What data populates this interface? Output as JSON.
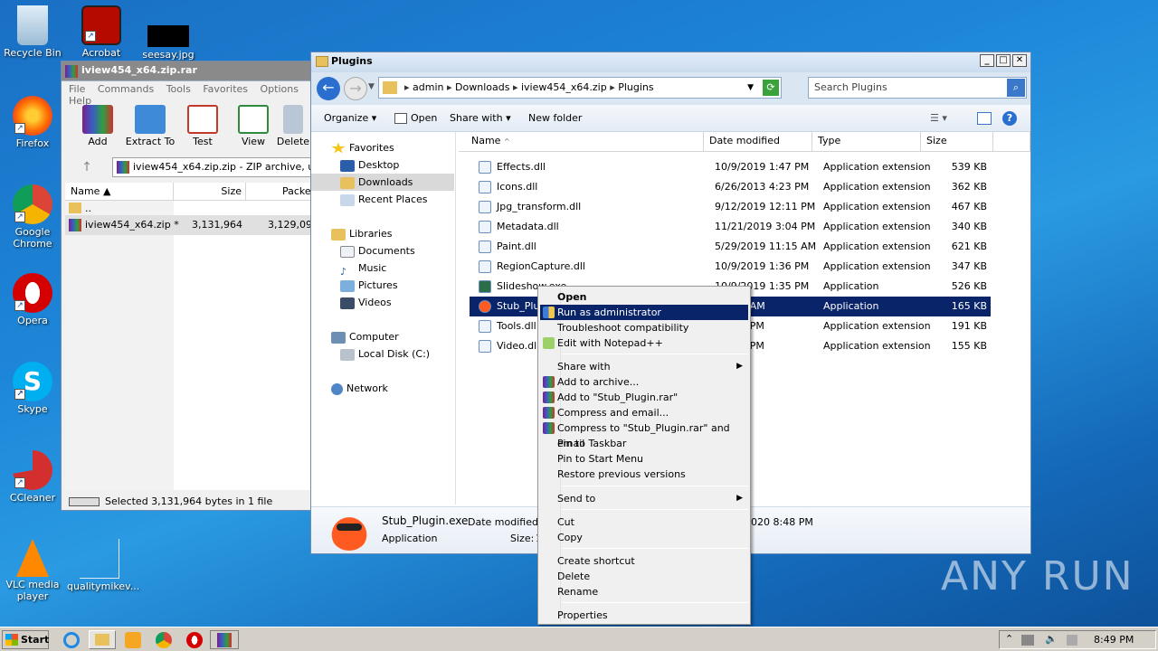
{
  "desktop": {
    "icons": [
      {
        "label": "Recycle Bin"
      },
      {
        "label": "Acrobat"
      },
      {
        "label": "seesay.jpg"
      },
      {
        "label": "Firefox"
      },
      {
        "label": "Google Chrome"
      },
      {
        "label": "Opera"
      },
      {
        "label": "Skype"
      },
      {
        "label": "CCleaner"
      },
      {
        "label": "VLC media player"
      },
      {
        "label": "qualitymikev..."
      }
    ],
    "watermark": "ANY RUN"
  },
  "rar": {
    "title": "iview454_x64.zip.rar",
    "menu": [
      "File",
      "Commands",
      "Tools",
      "Favorites",
      "Options",
      "Help"
    ],
    "toolbar": [
      "Add",
      "Extract To",
      "Test",
      "View",
      "Delete"
    ],
    "path": "iview454_x64.zip.zip - ZIP archive, unpa",
    "columns": [
      "Name",
      "Size",
      "Packed"
    ],
    "rows": [
      {
        "name": "..",
        "size": "",
        "packed": ""
      },
      {
        "name": "iview454_x64.zip *",
        "size": "3,131,964",
        "packed": "3,129,092"
      }
    ],
    "status": "Selected 3,131,964 bytes in 1 file"
  },
  "explorer": {
    "title": "Plugins",
    "breadcrumb": [
      "admin",
      "Downloads",
      "iview454_x64.zip",
      "Plugins"
    ],
    "search_placeholder": "Search Plugins",
    "commands": [
      "Organize",
      "Open",
      "Share with",
      "New folder"
    ],
    "nav": {
      "favorites": "Favorites",
      "desktop": "Desktop",
      "downloads": "Downloads",
      "recent": "Recent Places",
      "libraries": "Libraries",
      "documents": "Documents",
      "music": "Music",
      "pictures": "Pictures",
      "videos": "Videos",
      "computer": "Computer",
      "localdisk": "Local Disk (C:)",
      "network": "Network"
    },
    "columns": [
      "Name",
      "Date modified",
      "Type",
      "Size"
    ],
    "files": [
      {
        "name": "Effects.dll",
        "date": "10/9/2019 1:47 PM",
        "type": "Application extension",
        "size": "539 KB"
      },
      {
        "name": "Icons.dll",
        "date": "6/26/2013 4:23 PM",
        "type": "Application extension",
        "size": "362 KB"
      },
      {
        "name": "Jpg_transform.dll",
        "date": "9/12/2019 12:11 PM",
        "type": "Application extension",
        "size": "467 KB"
      },
      {
        "name": "Metadata.dll",
        "date": "11/21/2019 3:04 PM",
        "type": "Application extension",
        "size": "340 KB"
      },
      {
        "name": "Paint.dll",
        "date": "5/29/2019 11:15 AM",
        "type": "Application extension",
        "size": "621 KB"
      },
      {
        "name": "RegionCapture.dll",
        "date": "10/9/2019 1:36 PM",
        "type": "Application extension",
        "size": "347 KB"
      },
      {
        "name": "Slideshow.exe",
        "date": "10/9/2019 1:35 PM",
        "type": "Application",
        "size": "526 KB"
      },
      {
        "name": "Stub_Plugin.exe",
        "date": "9 7:09 AM",
        "type": "Application",
        "size": "165 KB"
      },
      {
        "name": "Tools.dll",
        "date": "9 1:33 PM",
        "type": "Application extension",
        "size": "191 KB"
      },
      {
        "name": "Video.dll",
        "date": "9 1:31 PM",
        "type": "Application extension",
        "size": "155 KB"
      }
    ],
    "details": {
      "name": "Stub_Plugin.exe",
      "date_label": "Date modified:",
      "date_value_partial": "1",
      "date_created_partial": "020 8:48 PM",
      "type": "Application",
      "size_label": "Size:",
      "size_value_partial": "1"
    }
  },
  "context_menu": {
    "items": [
      "Open",
      "Run as administrator",
      "Troubleshoot compatibility",
      "Edit with Notepad++",
      "Share with",
      "Add to archive...",
      "Add to \"Stub_Plugin.rar\"",
      "Compress and email...",
      "Compress to \"Stub_Plugin.rar\" and email",
      "Pin to Taskbar",
      "Pin to Start Menu",
      "Restore previous versions",
      "Send to",
      "Cut",
      "Copy",
      "Create shortcut",
      "Delete",
      "Rename",
      "Properties"
    ]
  },
  "taskbar": {
    "start_label": "Start",
    "clock": "8:49 PM"
  },
  "colors": {
    "selection": "#0a246a",
    "accent": "#3399ff"
  }
}
